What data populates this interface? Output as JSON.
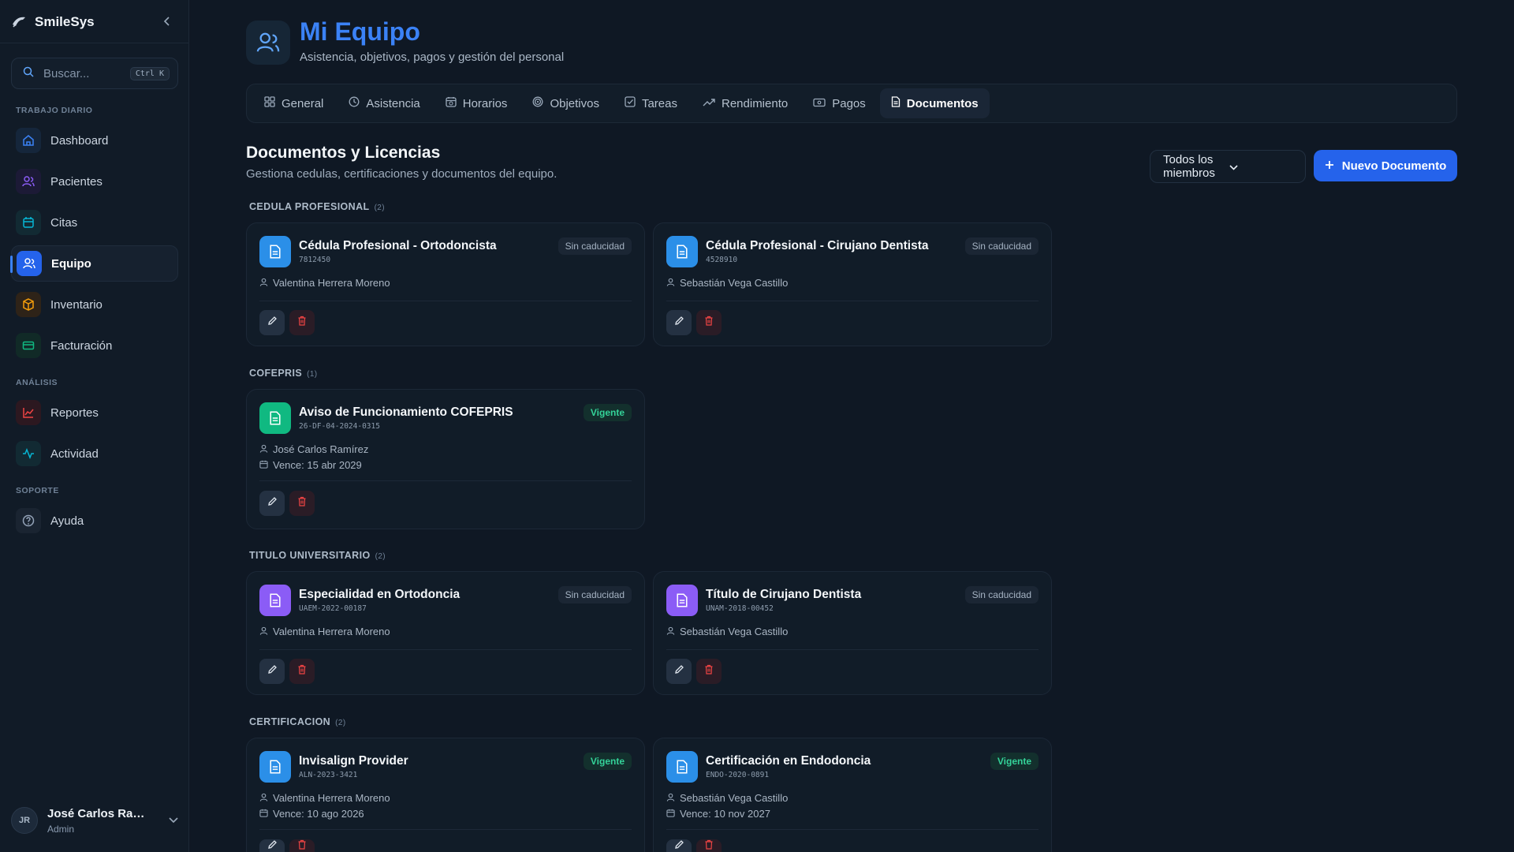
{
  "app": {
    "name": "SmileSys"
  },
  "search": {
    "placeholder": "Buscar...",
    "shortcut": "Ctrl K"
  },
  "sidebar": {
    "sections": [
      {
        "label": "TRABAJO DIARIO"
      },
      {
        "label": "ANÁLISIS"
      },
      {
        "label": "SOPORTE"
      }
    ],
    "items": [
      {
        "label": "Dashboard",
        "icon": "home-icon",
        "color": "#3b82f6"
      },
      {
        "label": "Pacientes",
        "icon": "users-icon",
        "color": "#8b5cf6"
      },
      {
        "label": "Citas",
        "icon": "calendar-icon",
        "color": "#06b6d4"
      },
      {
        "label": "Equipo",
        "icon": "team-icon",
        "color": "#3b82f6",
        "active": true
      },
      {
        "label": "Inventario",
        "icon": "box-icon",
        "color": "#f59e0b"
      },
      {
        "label": "Facturación",
        "icon": "card-icon",
        "color": "#10b981"
      },
      {
        "label": "Reportes",
        "icon": "chart-icon",
        "color": "#ef4444"
      },
      {
        "label": "Actividad",
        "icon": "activity-icon",
        "color": "#06b6d4"
      },
      {
        "label": "Ayuda",
        "icon": "help-icon",
        "color": "#94a3b8"
      }
    ]
  },
  "user": {
    "initials": "JR",
    "name": "José Carlos Ramír...",
    "role": "Admin"
  },
  "header": {
    "title": "Mi Equipo",
    "subtitle": "Asistencia, objetivos, pagos y gestión del personal"
  },
  "tabs": [
    {
      "label": "General",
      "icon": "grid-icon"
    },
    {
      "label": "Asistencia",
      "icon": "clock-icon"
    },
    {
      "label": "Horarios",
      "icon": "calendar-clock-icon"
    },
    {
      "label": "Objetivos",
      "icon": "target-icon"
    },
    {
      "label": "Tareas",
      "icon": "checkbox-icon"
    },
    {
      "label": "Rendimiento",
      "icon": "trend-icon"
    },
    {
      "label": "Pagos",
      "icon": "money-icon"
    },
    {
      "label": "Documentos",
      "icon": "document-icon",
      "active": true
    }
  ],
  "documents_section": {
    "title": "Documentos y Licencias",
    "description": "Gestiona cedulas, certificaciones y documentos del equipo.",
    "filter_value": "Todos los miembros",
    "new_button": "Nuevo Documento"
  },
  "groups": [
    {
      "label": "CEDULA PROFESIONAL",
      "count": "(2)",
      "docs": [
        {
          "title": "Cédula Profesional - Ortodoncista",
          "number": "7812450",
          "owner": "Valentina Herrera Moreno",
          "badge": "Sin caducidad",
          "color": "#2b8fe8"
        },
        {
          "title": "Cédula Profesional - Cirujano Dentista",
          "number": "4528910",
          "owner": "Sebastián Vega Castillo",
          "badge": "Sin caducidad",
          "color": "#2b8fe8"
        }
      ]
    },
    {
      "label": "COFEPRIS",
      "count": "(1)",
      "docs": [
        {
          "title": "Aviso de Funcionamiento COFEPRIS",
          "number": "26-DF-04-2024-0315",
          "owner": "José Carlos Ramírez",
          "expiry": "Vence: 15 abr 2029",
          "badge": "Vigente",
          "color": "#10b981"
        }
      ]
    },
    {
      "label": "TITULO UNIVERSITARIO",
      "count": "(2)",
      "docs": [
        {
          "title": "Especialidad en Ortodoncia",
          "number": "UAEM-2022-00187",
          "owner": "Valentina Herrera Moreno",
          "badge": "Sin caducidad",
          "color": "#8b5cf6"
        },
        {
          "title": "Título de Cirujano Dentista",
          "number": "UNAM-2018-00452",
          "owner": "Sebastián Vega Castillo",
          "badge": "Sin caducidad",
          "color": "#8b5cf6"
        }
      ]
    },
    {
      "label": "CERTIFICACION",
      "count": "(2)",
      "docs": [
        {
          "title": "Invisalign Provider",
          "number": "ALN-2023-3421",
          "owner": "Valentina Herrera Moreno",
          "expiry": "Vence: 10 ago 2026",
          "badge": "Vigente",
          "color": "#2b8fe8"
        },
        {
          "title": "Certificación en Endodoncia",
          "number": "ENDO-2020-0891",
          "owner": "Sebastián Vega Castillo",
          "expiry": "Vence: 10 nov 2027",
          "badge": "Vigente",
          "color": "#2b8fe8"
        }
      ]
    }
  ]
}
